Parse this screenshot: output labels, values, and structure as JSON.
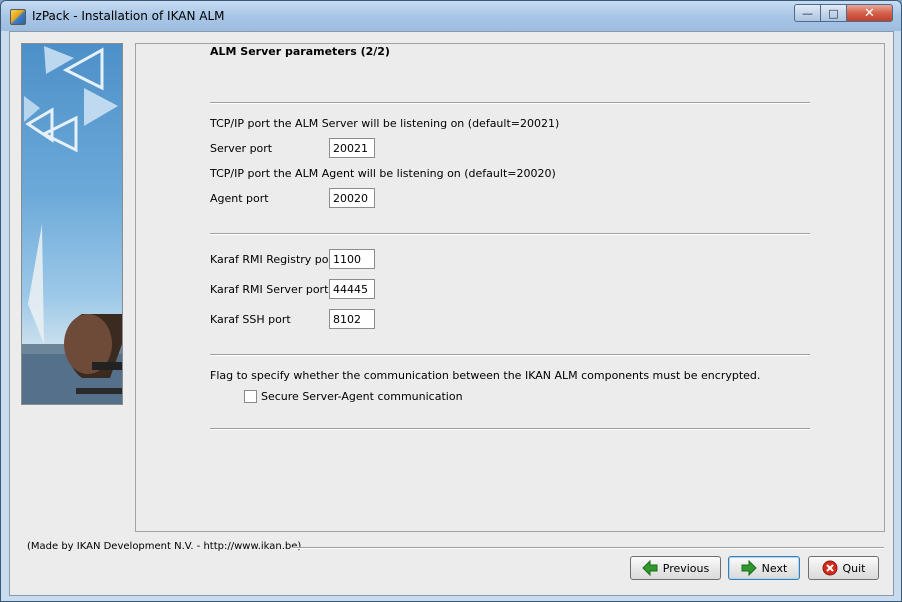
{
  "window": {
    "title": "IzPack - Installation of IKAN ALM",
    "minimize_glyph": "—",
    "maximize_glyph": "□",
    "close_glyph": "✕"
  },
  "panel": {
    "title": "ALM Server parameters (2/2)",
    "server_port_desc": "TCP/IP port the ALM Server will be listening on (default=20021)",
    "server_port_label": "Server port",
    "server_port_value": "20021",
    "agent_port_desc": "TCP/IP port the ALM Agent will be listening on (default=20020)",
    "agent_port_label": "Agent port",
    "agent_port_value": "20020",
    "karaf_rmi_registry_label": "Karaf RMI Registry port",
    "karaf_rmi_registry_value": "1100",
    "karaf_rmi_server_label": "Karaf RMI Server port",
    "karaf_rmi_server_value": "44445",
    "karaf_ssh_label": "Karaf SSH port",
    "karaf_ssh_value": "8102",
    "encrypt_desc": "Flag to specify whether the communication between the IKAN ALM components must be encrypted.",
    "secure_checkbox_label": "Secure Server-Agent communication",
    "secure_checked": false
  },
  "footer": {
    "made_by": "(Made by IKAN Development N.V. - http://www.ikan.be)",
    "previous_label": "Previous",
    "next_label": "Next",
    "quit_label": "Quit"
  },
  "icons": {
    "previous": "arrow-left-icon",
    "next": "arrow-right-icon",
    "quit": "cancel-icon"
  },
  "colors": {
    "arrow_green": "#2e9a2e",
    "quit_red": "#d42a1c",
    "titlebar": "#a9c6e6"
  }
}
